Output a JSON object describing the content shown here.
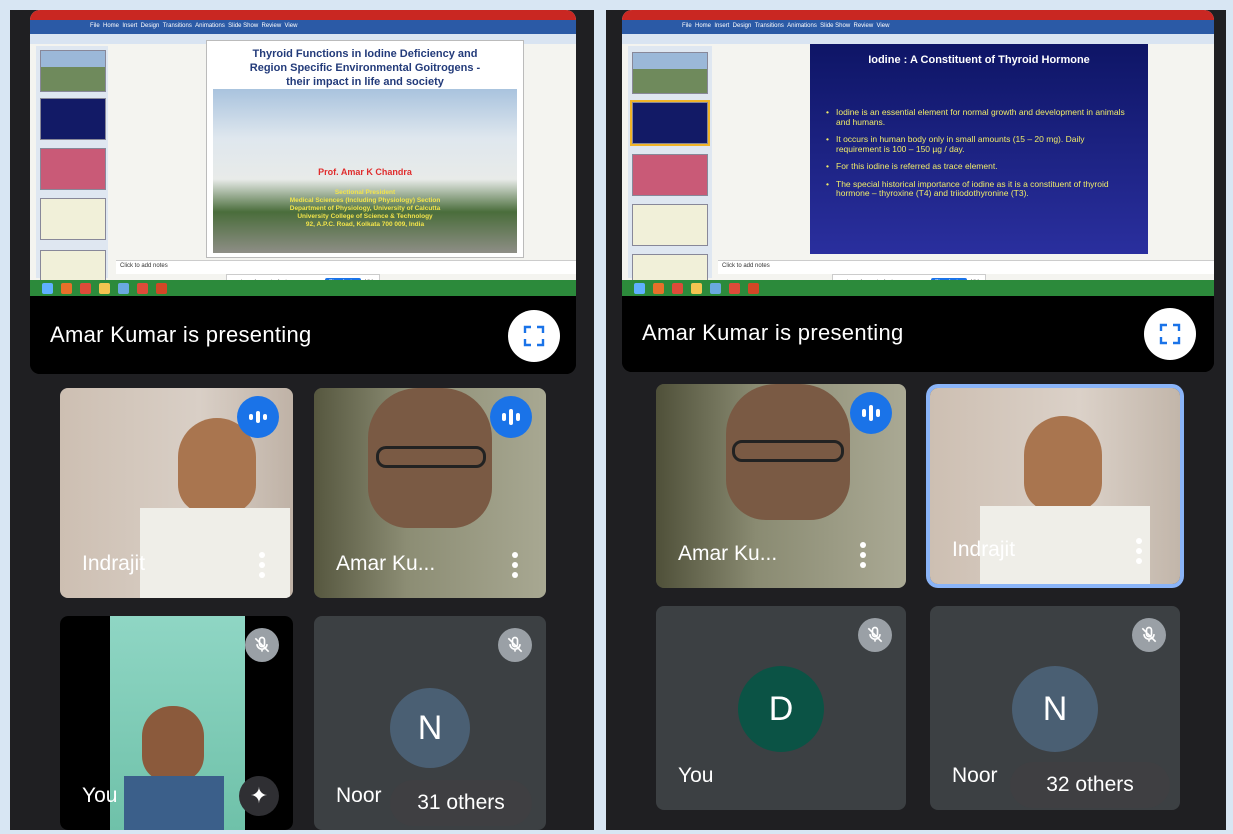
{
  "left": {
    "slide": {
      "title_line1": "Thyroid Functions in Iodine Deficiency and",
      "title_line2": "Region Specific Environmental Goitrogens -",
      "title_line3": "their impact in life and society",
      "presenter": "Prof. Amar K Chandra",
      "aff1": "Sectional President",
      "aff2": "Medical Sciences (Including Physiology) Section",
      "aff3": "Department of Physiology, University of Calcutta",
      "aff4": "University College of Science & Technology",
      "aff5": "92, A.P.C. Road, Kolkata 700 009, India"
    },
    "notes": "Click to add notes",
    "presenting": "Amar Kumar is presenting",
    "tiles": [
      {
        "name": "Indrajit"
      },
      {
        "name": "Amar Ku..."
      },
      {
        "name": "You"
      },
      {
        "name": "Noor",
        "avatar": "N",
        "others": "31 others"
      }
    ]
  },
  "right": {
    "slide": {
      "title": "Iodine : A Constituent of Thyroid Hormone",
      "bullets": [
        "Iodine is an essential element for normal growth and development in animals and humans.",
        "It occurs in human body only in small amounts (15 – 20 mg). Daily requirement is 100 – 150 µg / day.",
        "For this iodine is referred as trace element.",
        "The special historical importance of iodine as it is a constituent of thyroid hormone – thyroxine (T4) and triiodothyronine (T3)."
      ]
    },
    "notes": "Click to add notes",
    "presenting": "Amar Kumar is presenting",
    "tiles": [
      {
        "name": "Amar Ku..."
      },
      {
        "name": "Indrajit"
      },
      {
        "name": "You",
        "avatar": "D"
      },
      {
        "name": "Noor",
        "avatar": "N",
        "others": "32 others"
      }
    ]
  },
  "colors": {
    "tile_bg": "#3c4043",
    "speaking_blue": "#1a73e8",
    "highlight": "#8ab4f8",
    "avatar_green": "#0b5345",
    "avatar_slate": "#4a5f73"
  }
}
